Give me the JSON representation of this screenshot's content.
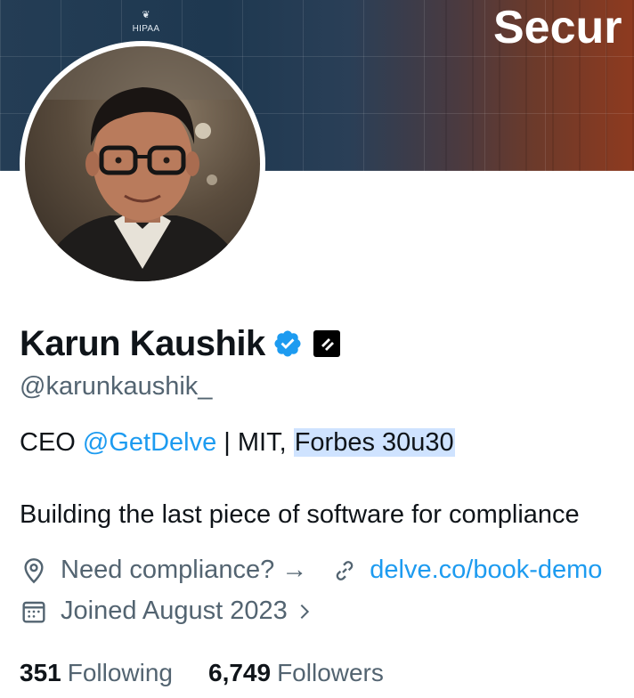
{
  "banner": {
    "badge_label": "HIPAA",
    "headline": "Secur"
  },
  "profile": {
    "name": "Karun Kaushik",
    "handle": "@karunkaushik_",
    "bio": {
      "prefix": "CEO ",
      "mention": "@GetDelve",
      "middle": " | MIT, ",
      "highlight": "Forbes 30u30",
      "line2": "Building the last piece of software for compliance"
    },
    "location": "Need compliance? →",
    "website": "delve.co/book-demo",
    "joined": "Joined August 2023",
    "following_count": "351",
    "following_label": "Following",
    "followers_count": "6,749",
    "followers_label": "Followers"
  },
  "icons": {
    "verified": "verified-badge-icon",
    "affiliation": "affiliate-logo-icon",
    "location": "location-pin-icon",
    "link": "link-icon",
    "calendar": "calendar-icon",
    "chevron": "chevron-right-icon"
  },
  "colors": {
    "accent": "#1d9bf0",
    "secondary_text": "#536471",
    "primary_text": "#0f1419",
    "highlight": "#cfe3ff"
  }
}
